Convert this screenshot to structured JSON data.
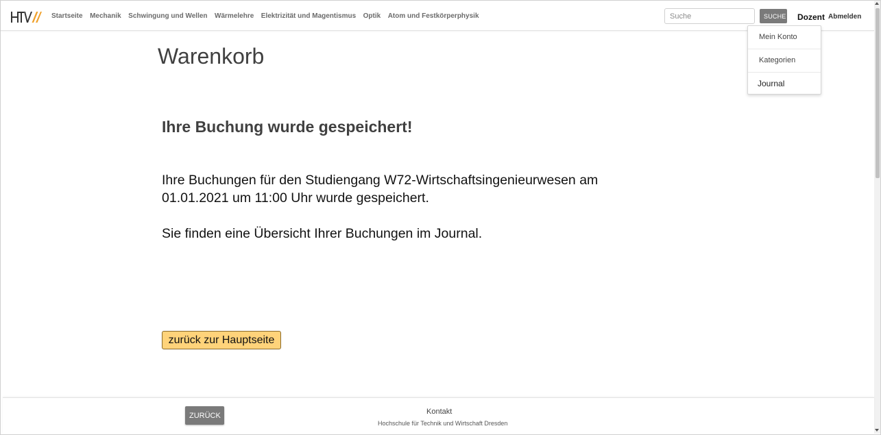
{
  "header": {
    "logo_text": "HTW",
    "nav": [
      "Startseite",
      "Mechanik",
      "Schwingung und Wellen",
      "Wärmelehre",
      "Elektrizität und Magentismus",
      "Optik",
      "Atom und Festkörperphysik"
    ],
    "search_placeholder": "Suche",
    "search_button": "SUCHE",
    "user": "Dozent",
    "logout": "Abmelden"
  },
  "user_menu": {
    "items": [
      "Mein Konto",
      "Kategorien",
      "Journal"
    ]
  },
  "main": {
    "title": "Warenkorb",
    "confirmation_heading": "Ihre Buchung wurde gespeichert!",
    "message_line1": "Ihre Buchungen für den Studiengang W72-Wirtschaftsingenieurwesen am 01.01.2021 um 11:00 Uhr wurde gespeichert.",
    "message_line2": "Sie finden eine Übersicht Ihrer Buchungen im Journal.",
    "home_button": "zurück zur Hauptseite"
  },
  "footer": {
    "back_button": "ZURÜCK",
    "contact": "Kontakt",
    "institution": "Hochschule für Technik und Wirtschaft Dresden"
  },
  "colors": {
    "accent_orange": "#f0a22e",
    "home_button_bg": "#ffd37a",
    "gray_button": "#7a7a7a"
  }
}
